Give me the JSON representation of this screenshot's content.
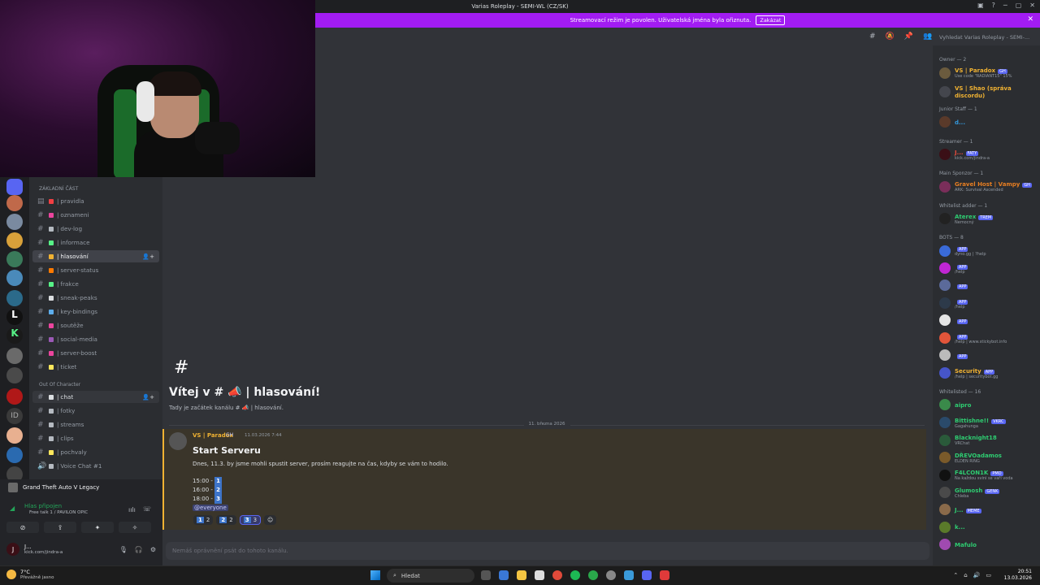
{
  "window": {
    "title": "Varias Roleplay - SEMI-WL (CZ/SK)"
  },
  "banner": {
    "text": "Streamovací režim je povolen. Uživatelská jména byla ořiznuta.",
    "disable_label": "Zakázat"
  },
  "search": {
    "placeholder": "Vyhledat Varias Roleplay - SEMI-..."
  },
  "categories": {
    "basic": "ZÁKLADNÍ ČÁST",
    "ooc": "Out Of Character"
  },
  "channels": [
    {
      "name": "pravidla",
      "color": "#f23f43"
    },
    {
      "name": "oznameni",
      "color": "#eb459e"
    },
    {
      "name": "dev-log",
      "color": "#b5bac1"
    },
    {
      "name": "informace",
      "color": "#57f287"
    },
    {
      "name": "hlasování",
      "color": "#f0b232"
    },
    {
      "name": "server-status",
      "color": "#ff7a00"
    },
    {
      "name": "frakce",
      "color": "#57f287"
    },
    {
      "name": "sneak-peaks",
      "color": "#dbdee1"
    },
    {
      "name": "key-bindings",
      "color": "#5dadec"
    },
    {
      "name": "soutěže",
      "color": "#eb459e"
    },
    {
      "name": "social-media",
      "color": "#9b59b6"
    },
    {
      "name": "server-boost",
      "color": "#eb459e"
    },
    {
      "name": "ticket",
      "color": "#fee75c"
    },
    {
      "name": "chat",
      "color": "#dbdee1"
    },
    {
      "name": "fotky",
      "color": "#b5bac1"
    },
    {
      "name": "streams",
      "color": "#b5bac1"
    },
    {
      "name": "clips",
      "color": "#b5bac1"
    },
    {
      "name": "pochvaly",
      "color": "#fee75c"
    },
    {
      "name": "Voice Chat #1",
      "color": "#b5bac1"
    }
  ],
  "game": {
    "name": "Grand Theft Auto V Legacy"
  },
  "voice": {
    "status": "Hlas připojen",
    "channel": "Free talk 1 / PAVILON OPIC"
  },
  "user": {
    "name": "J...",
    "status": "kick.com/jindra-a"
  },
  "welcome": {
    "hash": "#",
    "title": "Vítej v # 📣 | hlasování!",
    "subtitle": "Tady je začátek kanálu # 📣 | hlasování."
  },
  "divider_date": "11. března 2026",
  "message": {
    "author": "VS | Paradox",
    "tag": "GH",
    "time": "11.03.2026 7:44",
    "title": "Start Serveru",
    "body": "Dnes, 11.3. by jsme mohli spustit server, prosím reagujte na čas, kdyby se vám to hodilo.",
    "poll": [
      {
        "time": "15:00 -",
        "n": "1"
      },
      {
        "time": "16:00 -",
        "n": "2"
      },
      {
        "time": "18:00 -",
        "n": "3"
      }
    ],
    "mention": "@everyone",
    "reactions": [
      {
        "key": "1",
        "count": "2"
      },
      {
        "key": "2",
        "count": "2"
      },
      {
        "key": "3",
        "count": "3"
      }
    ]
  },
  "input": {
    "placeholder": "Nemáš oprávnění psát do tohoto kanálu."
  },
  "members": {
    "groups": [
      {
        "title": "Owner — 2",
        "items": [
          {
            "name": "VS | Paradox",
            "badge": "GH",
            "status": "Use code \"RADIANT15\" 15%",
            "color": "#f0b232",
            "av": "#6b5b3e"
          },
          {
            "name": "VS | Shao (správa discordu)",
            "badge": "",
            "status": "",
            "color": "#f0b232",
            "av": "#44464d"
          }
        ]
      },
      {
        "title": "Junior Staff — 1",
        "items": [
          {
            "name": "d...",
            "badge": "",
            "status": "",
            "color": "#3498db",
            "av": "#5a3a2a"
          }
        ]
      },
      {
        "title": "Streamer — 1",
        "items": [
          {
            "name": "J...",
            "badge": "FATY",
            "status": "kick.com/jindra-a",
            "color": "#e74c3c",
            "av": "#3a0f16"
          }
        ]
      },
      {
        "title": "Main Sponzor — 1",
        "items": [
          {
            "name": "Gravel Host | Vampy",
            "badge": "GH",
            "status": "ARK: Survival Ascended",
            "color": "#e67e22",
            "av": "#7a2e5a"
          }
        ]
      },
      {
        "title": "Whitelist adder — 1",
        "items": [
          {
            "name": "Aterex",
            "badge": "TREM",
            "status": "Nemocný",
            "color": "#2ecc71",
            "av": "#222"
          }
        ]
      },
      {
        "title": "BOTS — 8",
        "items": [
          {
            "name": "",
            "badge": "APP",
            "status": "dyno.gg | ?help",
            "color": "#dbdee1",
            "av": "#3a6bd9"
          },
          {
            "name": "",
            "badge": "APP",
            "status": "/help",
            "color": "#dbdee1",
            "av": "#c026d3"
          },
          {
            "name": "",
            "badge": "APP",
            "status": "",
            "color": "#dbdee1",
            "av": "#5b6a9a"
          },
          {
            "name": "",
            "badge": "APP",
            "status": "/help",
            "color": "#dbdee1",
            "av": "#2d3a4a"
          },
          {
            "name": "",
            "badge": "APP",
            "status": "",
            "color": "#dbdee1",
            "av": "#e5e5e5"
          },
          {
            "name": "",
            "badge": "APP",
            "status": "/help | www.stickybot.info",
            "color": "#dbdee1",
            "av": "#e2553a"
          },
          {
            "name": "",
            "badge": "APP",
            "status": "",
            "color": "#dbdee1",
            "av": "#bbbbbb"
          },
          {
            "name": "Security",
            "badge": "APP",
            "status": "/help | securitybot.gg",
            "color": "#f0b232",
            "av": "#4655c9"
          }
        ]
      },
      {
        "title": "Whitelisted — 16",
        "items": [
          {
            "name": "aipro",
            "badge": "",
            "status": "",
            "color": "#2ecc71",
            "av": "#3a8a4a"
          },
          {
            "name": "Bittishne!!",
            "badge": "VKRC",
            "status": "Gagahunga",
            "color": "#2ecc71",
            "av": "#2a4a6a"
          },
          {
            "name": "Blacknight18",
            "badge": "",
            "status": "VRChat",
            "color": "#2ecc71",
            "av": "#2a5a3a"
          },
          {
            "name": "DŘEVOadamos",
            "badge": "",
            "status": "ELDEN RING",
            "color": "#2ecc71",
            "av": "#7a5a2a"
          },
          {
            "name": "F4LCON1K",
            "badge": "PMD",
            "status": "Na každou svini se vaří voda",
            "color": "#2ecc71",
            "av": "#111"
          },
          {
            "name": "Glumosh",
            "badge": "GENK",
            "status": "Chleba",
            "color": "#2ecc71",
            "av": "#4a4a4a"
          },
          {
            "name": "J...",
            "badge": "MEME",
            "status": "",
            "color": "#2ecc71",
            "av": "#8a6a4a"
          },
          {
            "name": "k...",
            "badge": "",
            "status": "",
            "color": "#2ecc71",
            "av": "#5a7a2a"
          },
          {
            "name": "Mafulo",
            "badge": "",
            "status": "",
            "color": "#2ecc71",
            "av": "#a04ab0"
          }
        ]
      }
    ]
  },
  "taskbar": {
    "temp": "7°C",
    "weather": "Převážně jasno",
    "search": "Hledat",
    "time": "20:51",
    "date": "13.03.2026"
  }
}
